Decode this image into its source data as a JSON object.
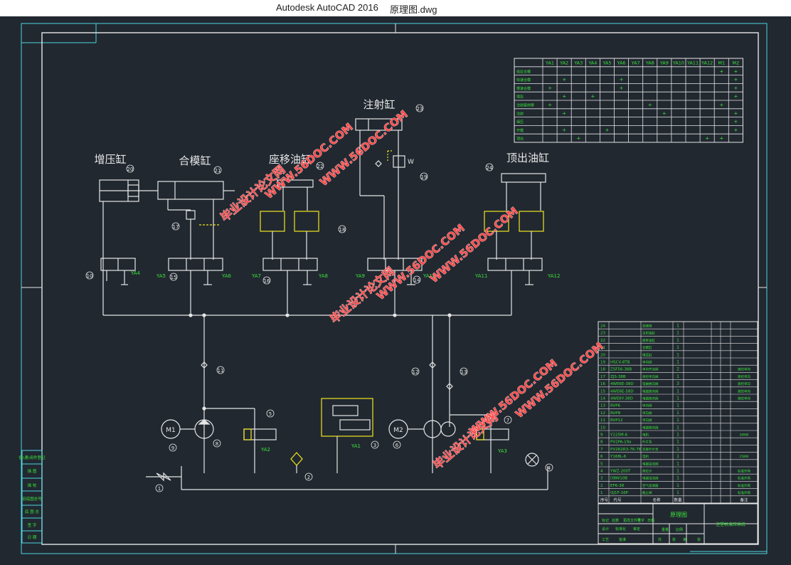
{
  "window": {
    "app_title": "Autodesk AutoCAD 2016",
    "file_name": "原理图.dwg"
  },
  "drawing": {
    "cylinders": {
      "booster": "增压缸",
      "mold_closing": "合模缸",
      "seat_move": "座移油缸",
      "injection": "注射缸",
      "ejector": "顶出油缸"
    },
    "solenoids": [
      "YA1",
      "YA2",
      "YA3",
      "YA4",
      "YA5",
      "YA6",
      "YA7",
      "YA8",
      "YA9",
      "YA10",
      "YA11",
      "YA12"
    ],
    "motors": [
      "M1",
      "M2"
    ],
    "callouts": [
      "1",
      "2",
      "3",
      "4",
      "5",
      "6",
      "7",
      "8",
      "9",
      "10",
      "11",
      "12",
      "13",
      "14",
      "15",
      "16",
      "17",
      "18",
      "19",
      "20",
      "21",
      "22",
      "23",
      "24"
    ],
    "valve_marker": "W"
  },
  "action_table": {
    "headers": [
      "",
      "YA1",
      "YA2",
      "YA3",
      "YA4",
      "YA5",
      "YA6",
      "YA7",
      "YA8",
      "YA9",
      "YA10",
      "YA11",
      "YA12",
      "M1",
      "M2"
    ],
    "rows": [
      [
        "低压合模",
        "",
        "",
        "",
        "",
        "",
        "",
        "",
        "",
        "",
        "",
        "",
        "",
        "+",
        "+"
      ],
      [
        "快速合模",
        "",
        "+",
        "",
        "",
        "",
        "+",
        "",
        "",
        "",
        "",
        "",
        "",
        "",
        "+"
      ],
      [
        "慢速合模",
        "+",
        "",
        "",
        "",
        "",
        "+",
        "",
        "",
        "",
        "",
        "",
        "",
        "",
        "+"
      ],
      [
        "增压",
        "",
        "+",
        "",
        "+",
        "",
        "",
        "",
        "",
        "",
        "",
        "",
        "",
        "",
        "+"
      ],
      [
        "注射座前移",
        "+",
        "",
        "",
        "",
        "",
        "",
        "",
        "+",
        "",
        "",
        "",
        "",
        "+",
        ""
      ],
      [
        "注射",
        "",
        "+",
        "",
        "",
        "",
        "",
        "",
        "",
        "+",
        "",
        "",
        "",
        "",
        "+"
      ],
      [
        "保压",
        "",
        "",
        "",
        "",
        "",
        "",
        "",
        "",
        "",
        "",
        "",
        "",
        "",
        "+"
      ],
      [
        "开模",
        "",
        "+",
        "",
        "",
        "+",
        "",
        "",
        "",
        "",
        "",
        "",
        "",
        "",
        "+"
      ],
      [
        "顶出",
        "",
        "",
        "+",
        "",
        "",
        "",
        "",
        "",
        "",
        "",
        "",
        "+",
        "+",
        ""
      ]
    ]
  },
  "parts_list": {
    "rows": [
      [
        "24",
        "",
        "调速阀",
        "1",
        ""
      ],
      [
        "23",
        "",
        "注射油缸",
        "1",
        ""
      ],
      [
        "22",
        "",
        "座移油缸",
        "1",
        ""
      ],
      [
        "21",
        "",
        "合模缸",
        "1",
        ""
      ],
      [
        "20",
        "",
        "增压缸",
        "1",
        ""
      ],
      [
        "19",
        "HSCV-8TB",
        "单向阀",
        "1",
        ""
      ],
      [
        "18",
        "ZSF56-38B",
        "单向节流阀",
        "2",
        "液控单向"
      ],
      [
        "17",
        "ZJS-38B",
        "液控单向阀",
        "1",
        "液控单向"
      ],
      [
        "16",
        "4WE6E-38D",
        "电磁换向阀",
        "3",
        "液控单向"
      ],
      [
        "15",
        "4WE6E-58D",
        "电磁换向阀",
        "1",
        "液控单向"
      ],
      [
        "14",
        "4WE6Y-38D",
        "电磁换向阀",
        "1",
        "液控单向"
      ],
      [
        "13",
        "RVP6",
        "单向阀",
        "1",
        ""
      ],
      [
        "12",
        "RVP8",
        "单向阀",
        "1",
        ""
      ],
      [
        "11",
        "RVP12",
        "单向阀",
        "1",
        ""
      ],
      [
        "10",
        "",
        "电磁换向阀",
        "1",
        ""
      ],
      [
        "9",
        "Y225M-6",
        "电机",
        "1",
        "30KW"
      ],
      [
        "8",
        "PV2PA-19a",
        "叶片泵",
        "1",
        ""
      ],
      [
        "7",
        "PV2R2R3-76-76",
        "双联叶片泵",
        "1",
        ""
      ],
      [
        "6",
        "Y168L-6",
        "电机",
        "1",
        "15KW"
      ],
      [
        "5",
        "",
        "电磁溢流阀",
        "1",
        ""
      ],
      [
        "4",
        "YWZ-200T",
        "液位计",
        "1",
        "标准外购"
      ],
      [
        "3",
        "DBW10B",
        "电磁溢流阀",
        "1",
        "标准外购"
      ],
      [
        "2",
        "EF6-38",
        "空气滤清器",
        "1",
        "标准外购"
      ],
      [
        "1",
        "QJ1F-16P",
        "截止阀",
        "1",
        "标准外购"
      ]
    ],
    "header": [
      "序号",
      "代号",
      "名称",
      "数量",
      "备注"
    ],
    "drawing_title": "原理图",
    "project_name": "注塑机液压系统"
  },
  "left_strip": [
    "借(通)用件登记",
    "描 图",
    "描 校",
    "旧底图总号",
    "底 图 总",
    "签 字",
    "日 期"
  ],
  "title_block_cells": [
    "标记",
    "处数",
    "更改文件号",
    "签字",
    "日期",
    "设计",
    "标准化",
    "审定",
    "工艺",
    "批准",
    "重量",
    "比例",
    "共",
    "张",
    "第",
    "张"
  ],
  "watermarks": [
    "毕业设计论文网",
    "WWW.56DOC.COM"
  ],
  "colors": {
    "background": "#212830",
    "line_white": "#e6e6e6",
    "frame_cyan": "#4fd5e0",
    "label_green": "#3be23b",
    "yellow": "#f2e61f",
    "watermark_red": "#ff4d4d"
  }
}
